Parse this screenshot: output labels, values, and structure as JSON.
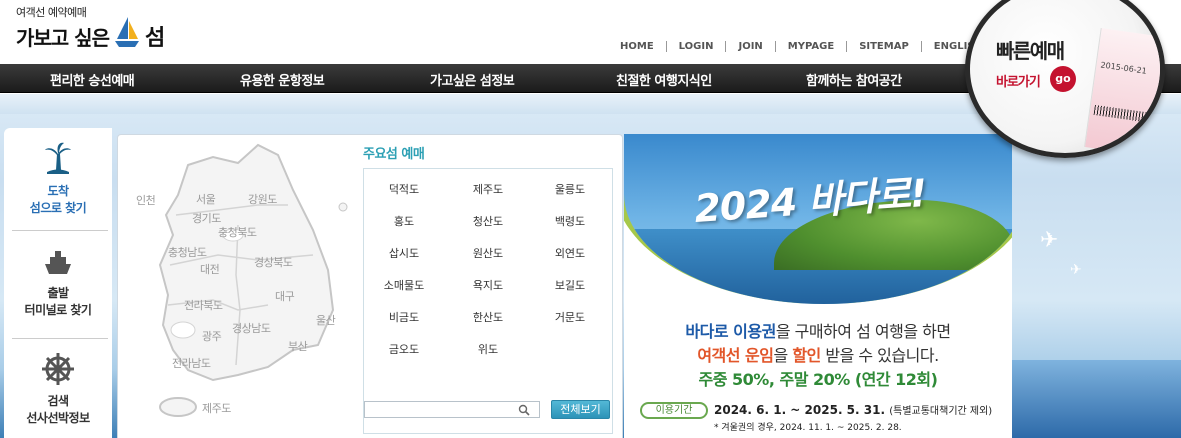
{
  "header": {
    "logo_sub": "여객선 예약예매",
    "logo_main_start": "가보고 싶은",
    "logo_main_end": "섬"
  },
  "topnav": [
    "HOME",
    "LOGIN",
    "JOIN",
    "MYPAGE",
    "SITEMAP",
    "ENGLISH"
  ],
  "menu": [
    "편리한 승선예매",
    "유용한 운항정보",
    "가고싶은 섬정보",
    "친절한 여행지식인",
    "함께하는 참여공간"
  ],
  "quick": {
    "title": "빠른예매",
    "go_label": "바로가기",
    "go": "go",
    "ticket_date": "2015-06-21"
  },
  "sidebar": [
    {
      "line1": "도착",
      "line2": "섬으로 찾기"
    },
    {
      "line1": "출발",
      "line2": "터미널로 찾기"
    },
    {
      "line1": "검색",
      "line2": "선사선박정보"
    }
  ],
  "map_regions": [
    "인천",
    "서울",
    "강원도",
    "경기도",
    "충청북도",
    "충청남도",
    "대전",
    "경상북도",
    "대구",
    "전라북도",
    "울산",
    "광주",
    "경상남도",
    "부산",
    "전라남도",
    "제주도"
  ],
  "islands_title": "주요섬 예매",
  "islands": [
    "덕적도",
    "제주도",
    "울릉도",
    "홍도",
    "청산도",
    "백령도",
    "삽시도",
    "원산도",
    "외연도",
    "소매물도",
    "욕지도",
    "보길도",
    "비금도",
    "한산도",
    "거문도",
    "금오도",
    "위도"
  ],
  "search": {
    "placeholder": "",
    "all_button": "전체보기"
  },
  "banner": {
    "title": "2024 바다로!",
    "l1_a": "바다로 이용권",
    "l1_b": "을 구매하여 섬 여행을 하면",
    "l2_a": "여객선 운임",
    "l2_b": "을 ",
    "l2_c": "할인",
    "l2_d": " 받을 수 있습니다.",
    "l3": "주중 50%, 주말 20% (연간 12회)",
    "period_badge": "이용기간",
    "period": "2024. 6. 1. ~ 2025. 5. 31.",
    "period_note_small": "(특별교통대책기간 제외)",
    "note": "* 겨울권의 경우, 2024. 11. 1. ~ 2025. 2. 28."
  }
}
